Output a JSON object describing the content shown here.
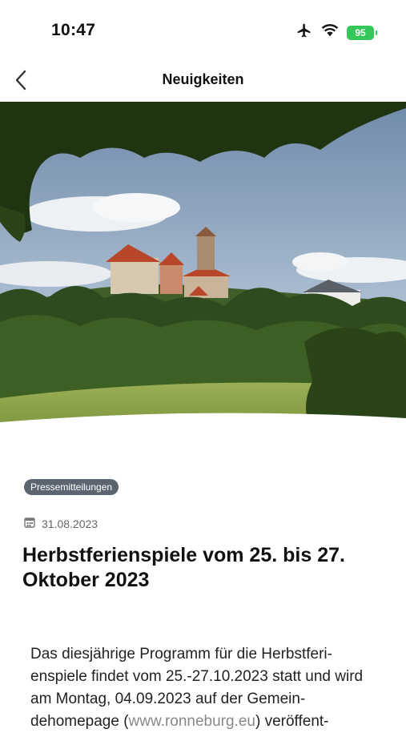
{
  "status_bar": {
    "time": "10:47",
    "battery": "95"
  },
  "nav": {
    "title": "Neuigkeiten"
  },
  "article": {
    "category": "Pressemitteilungen",
    "date": "31.08.2023",
    "title": "Herbstferienspiele vom 25. bis 27. Oktober 2023",
    "body_before_link": "Das diesjährige Programm für die Herbstferi-enspiele findet vom 25.-27.10.2023 statt und wird am Montag, 04.09.2023 auf der Gemein-dehomepage (",
    "link_text": "www.ronneburg.eu",
    "body_after_link": ") veröffent-"
  },
  "colors": {
    "battery": "#34c759",
    "badge": "#5a6570",
    "link": "#888888"
  }
}
